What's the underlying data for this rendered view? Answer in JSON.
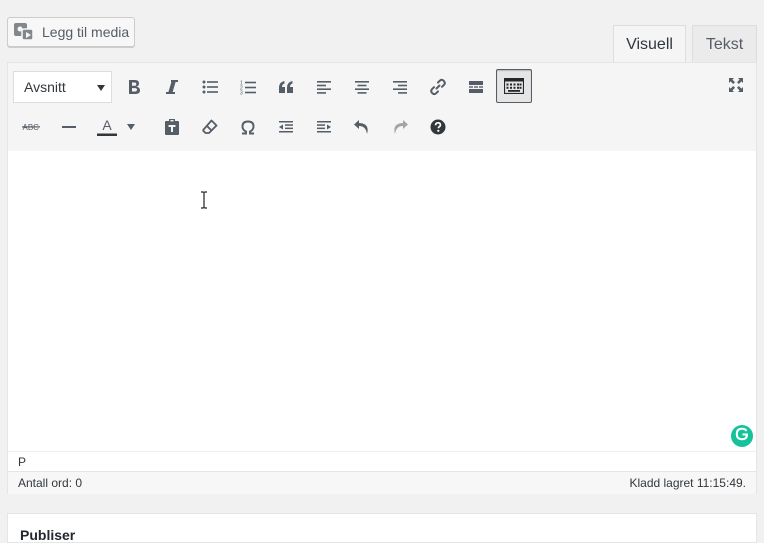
{
  "media_button": {
    "label": "Legg til media",
    "icon": "media-icon"
  },
  "tabs": [
    {
      "label": "Visuell",
      "active": true
    },
    {
      "label": "Tekst",
      "active": false
    }
  ],
  "toolbar": {
    "format_select": "Avsnitt",
    "row1": [
      "bold",
      "italic",
      "bulleted-list",
      "numbered-list",
      "blockquote",
      "align-left",
      "align-center",
      "align-right",
      "insert-link",
      "read-more",
      "toolbar-toggle"
    ],
    "row2": [
      "strikethrough",
      "horizontal-line",
      "text-color",
      "text-color-dropdown",
      "paste-as-text",
      "clear-formatting",
      "special-character",
      "decrease-indent",
      "increase-indent",
      "undo",
      "redo",
      "keyboard-shortcuts"
    ],
    "fullscreen": "fullscreen-icon",
    "active_button": "toolbar-toggle",
    "text_color_glyph": "A"
  },
  "path_bar": {
    "path": "P"
  },
  "status_bar": {
    "word_count": "Antall ord: 0",
    "draft_saved": "Kladd lagret 11:15:49."
  },
  "bottom_box": {
    "title": "Publiser"
  },
  "colors": {
    "background": "#f1f1f1",
    "toolbar": "#f5f5f5",
    "icon": "#555d66",
    "grammarly": "#15c39a"
  }
}
